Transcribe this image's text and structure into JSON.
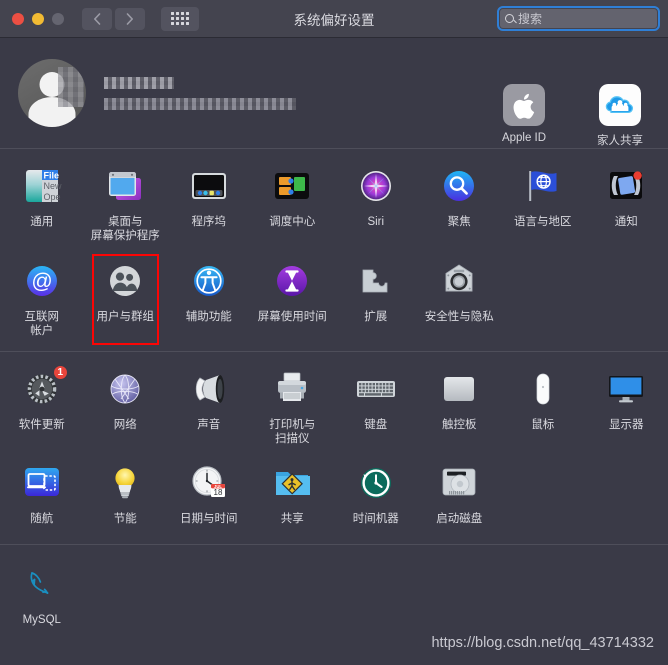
{
  "window": {
    "title": "系统偏好设置",
    "traffic_lights": [
      "close",
      "minimize",
      "zoom"
    ],
    "nav_back": "‹",
    "nav_forward": "›",
    "grid_button": "show-all-grid"
  },
  "search": {
    "placeholder": "搜索",
    "value": "",
    "icon": "search-icon",
    "focused": true,
    "focus_ring_color": "#2f7fd6"
  },
  "account": {
    "avatar": "user-avatar-placeholder",
    "name": "",
    "email": "",
    "censored": true,
    "items": [
      {
        "label": "Apple ID",
        "icon": "apple-logo-icon"
      },
      {
        "label": "家人共享",
        "icon": "family-sharing-icon"
      }
    ]
  },
  "panes": [
    {
      "id": "pane-1",
      "items": [
        {
          "label": "通用",
          "icon": "general-icon"
        },
        {
          "label": "桌面与\n屏幕保护程序",
          "icon": "desktop-screensaver-icon"
        },
        {
          "label": "程序坞",
          "icon": "dock-icon"
        },
        {
          "label": "调度中心",
          "icon": "mission-control-icon"
        },
        {
          "label": "Siri",
          "icon": "siri-icon"
        },
        {
          "label": "聚焦",
          "icon": "spotlight-icon"
        },
        {
          "label": "语言与地区",
          "icon": "language-region-icon"
        },
        {
          "label": "通知",
          "icon": "notifications-icon"
        },
        {
          "label": "互联网\n帐户",
          "icon": "internet-accounts-icon"
        },
        {
          "label": "用户与群组",
          "icon": "users-groups-icon",
          "selected": true
        },
        {
          "label": "辅助功能",
          "icon": "accessibility-icon"
        },
        {
          "label": "屏幕使用时间",
          "icon": "screen-time-icon"
        },
        {
          "label": "扩展",
          "icon": "extensions-icon"
        },
        {
          "label": "安全性与隐私",
          "icon": "security-privacy-icon"
        }
      ]
    },
    {
      "id": "pane-2",
      "items": [
        {
          "label": "软件更新",
          "icon": "software-update-icon",
          "badge": "1"
        },
        {
          "label": "网络",
          "icon": "network-icon"
        },
        {
          "label": "声音",
          "icon": "sound-icon"
        },
        {
          "label": "打印机与\n扫描仪",
          "icon": "printers-scanners-icon"
        },
        {
          "label": "键盘",
          "icon": "keyboard-icon"
        },
        {
          "label": "触控板",
          "icon": "trackpad-icon"
        },
        {
          "label": "鼠标",
          "icon": "mouse-icon"
        },
        {
          "label": "显示器",
          "icon": "displays-icon"
        },
        {
          "label": "随航",
          "icon": "sidecar-icon"
        },
        {
          "label": "节能",
          "icon": "energy-saver-icon"
        },
        {
          "label": "日期与时间",
          "icon": "date-time-icon",
          "glyph_month": "JUL",
          "glyph_day": "18"
        },
        {
          "label": "共享",
          "icon": "sharing-icon"
        },
        {
          "label": "时间机器",
          "icon": "time-machine-icon"
        },
        {
          "label": "启动磁盘",
          "icon": "startup-disk-icon"
        }
      ]
    },
    {
      "id": "pane-3",
      "items": [
        {
          "label": "MySQL",
          "icon": "mysql-dolphin-icon"
        }
      ]
    }
  ],
  "watermark": {
    "text": "https://blog.csdn.net/qq_43714332"
  },
  "colors": {
    "window_bg": "#3a3a47",
    "titlebar_bg": "#44444f",
    "selection_outline": "#fb0505",
    "text": "#d9d9df",
    "divider": "#4e4e5a"
  }
}
